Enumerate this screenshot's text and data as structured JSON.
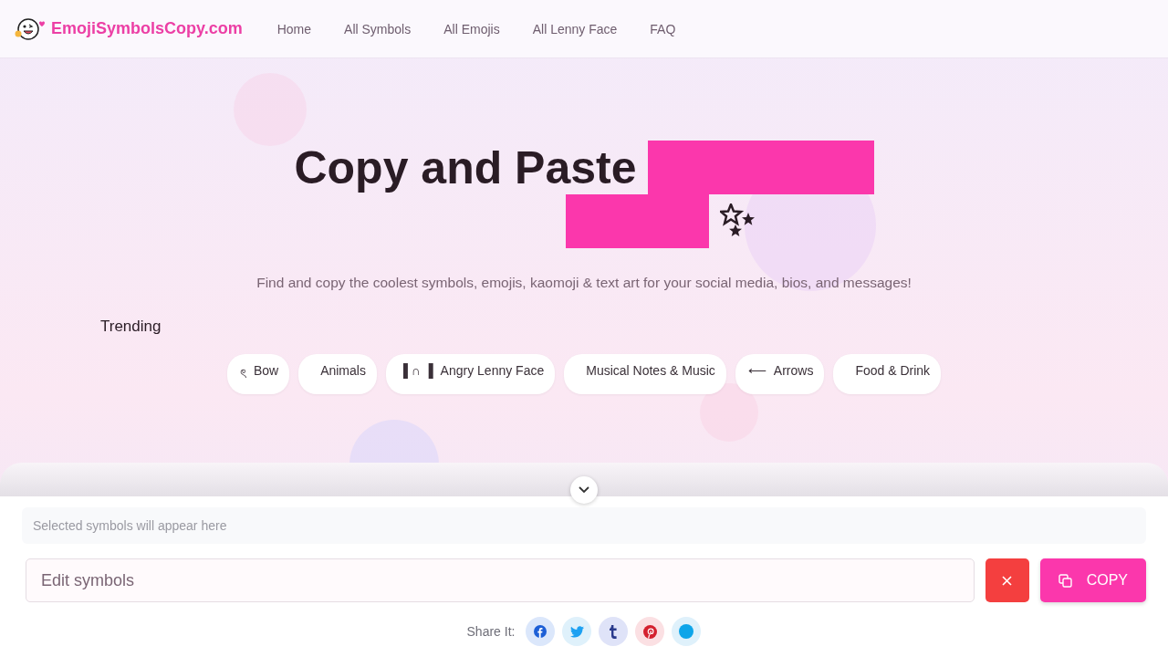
{
  "header": {
    "logo": "EmojiSymbolsCopy.com",
    "nav": [
      {
        "label": "Home"
      },
      {
        "label": "All Symbols"
      },
      {
        "label": "All Emojis"
      },
      {
        "label": "All Lenny Face"
      },
      {
        "label": "FAQ"
      }
    ]
  },
  "hero": {
    "title": "Copy and Paste",
    "subtitle": "Find and copy the coolest symbols, emojis, kaomoji & text art for your social media, bios, and messages!"
  },
  "trending": {
    "heading": "Trending",
    "chips": [
      {
        "symbol": "ৎ",
        "label": "Bow"
      },
      {
        "label": "Animals"
      },
      {
        "symbol": "▐ ∩ ▐",
        "label": "Angry Lenny Face"
      },
      {
        "label": "Musical Notes & Music"
      },
      {
        "symbol": "⟵",
        "label": "Arrows"
      },
      {
        "label": "Food & Drink"
      }
    ]
  },
  "copy_panel": {
    "preview_placeholder": "Selected symbols will appear here",
    "input_placeholder": "Edit symbols",
    "copy_label": "COPY",
    "share_label": "Share It:",
    "share": [
      {
        "kind": "facebook"
      },
      {
        "kind": "twitter"
      },
      {
        "kind": "tumblr"
      },
      {
        "kind": "pinterest"
      },
      {
        "kind": "other"
      }
    ]
  }
}
